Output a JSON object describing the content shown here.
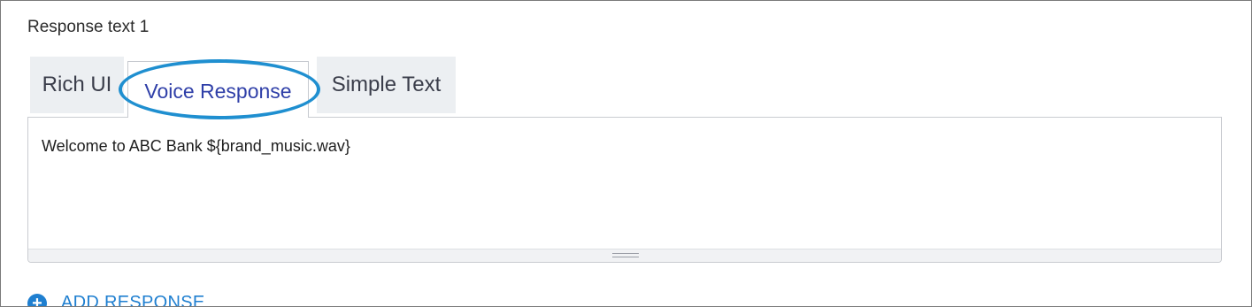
{
  "section": {
    "title": "Response text 1"
  },
  "tabs": [
    {
      "label": "Rich UI",
      "active": false
    },
    {
      "label": "Voice Response",
      "active": true
    },
    {
      "label": "Simple Text",
      "active": false
    }
  ],
  "editor": {
    "value": "Welcome to ABC Bank ${brand_music.wav}"
  },
  "actions": {
    "add_response_label": "ADD RESPONSE",
    "add_response_icon": "plus-circle-icon"
  },
  "colors": {
    "accent": "#1f7fd0",
    "highlight": "#1f8fd0",
    "active_tab_text": "#2f3fa8",
    "tab_bg": "#eceff2"
  }
}
